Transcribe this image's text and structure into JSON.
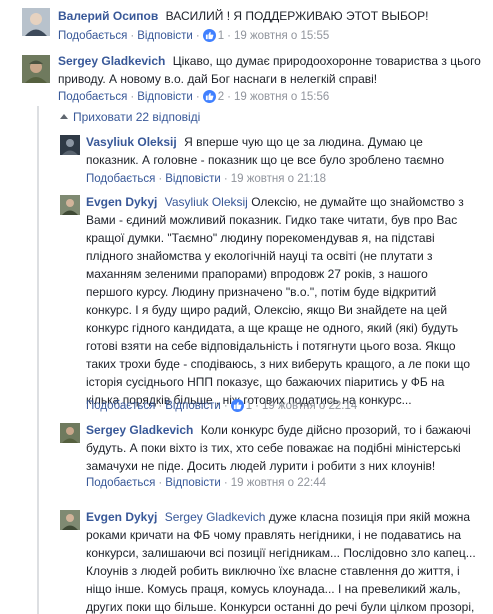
{
  "comments": [
    {
      "author": "Валерий Осипов",
      "text": "ВАСИЛИЙ ! Я ПОДДЕРЖИВАЮ ЭТОТ ВЫБОР!",
      "like_label": "Подобається",
      "reply_label": "Відповісти",
      "likes": "1",
      "time": "19 жовтня о 15:55"
    },
    {
      "author": "Sergey Gladkevich",
      "text": "Цікаво, що думає природоохоронне товариства з цього приводу. А новому в.о. дай Бог наснаги в нелегкій справі!",
      "like_label": "Подобається",
      "reply_label": "Відповісти",
      "likes": "2",
      "time": "19 жовтня о 15:56"
    }
  ],
  "hide_replies_label": "Приховати 22 відповіді",
  "replies": [
    {
      "author": "Vasyliuk Oleksij",
      "text": "Я вперше чую що це за людина. Думаю це показник. А головне - показник що це все було зроблено таємно",
      "like_label": "Подобається",
      "reply_label": "Відповісти",
      "time": "19 жовтня о 21:18"
    },
    {
      "author": "Evgen Dykyj",
      "mention": "Vasyliuk Oleksij",
      "text": "Олексію, не думайте що знайомство з Вами - єдиний можливий показник. Гидко таке читати, був про Вас кращої думки. \"Таємно\" людину порекомендував я, на підставі плідного знайомства у екологічній науці та освіті (не плутати з маханням зеленими прапорами) впродовж 27 років, з нашого першого курсу. Людину призначено \"в.о.\", потім буде відкритий конкурс. І я буду щиро радий, Олексію, якщо Ви знайдете на цей конкурс гідного кандидата, а ще краще не одного, який (які) будуть готові взяти на себе відповідальність і потягнути цього воза. Якщо таких трохи буде - сподіваюсь, з них виберуть кращого, а ле поки що історія сусіднього НПП показує, що бажаючих піаритись у ФБ на кілька порядків більше , ніж готових податись на конкурс...",
      "like_label": "Подобається",
      "reply_label": "Відповісти",
      "likes": "1",
      "time": "19 жовтня о 22:14"
    },
    {
      "author": "Sergey Gladkevich",
      "text": "Коли конкурс буде дійсно прозорий, то і бажаючі будуть. А поки віхто із тих, хто себе поважає на подібні міністерські замачухи не піде. Досить людей лурити і робити з них клоунів!",
      "like_label": "Подобається",
      "reply_label": "Відповісти",
      "time": "19 жовтня о 22:44"
    },
    {
      "author": "Evgen Dykyj",
      "mention": "Sergey Gladkevich",
      "text": "дуже класна позиція при якій можна роками кричати на ФБ чому правлять негідники, і не подаватись на конкурси, залишаючи всі позиції негідникам... Послідовно зло капец... Клоунів з людей робить виключно їхє власне ставлення до життя, і ніщо інше. Комусь праця, комусь клоунада... І на превеликий жаль, других поки що більше. Конкурси останні до речі були цілком прозорі, і це дозволило громадськості принаймні не пропустити"
    }
  ]
}
